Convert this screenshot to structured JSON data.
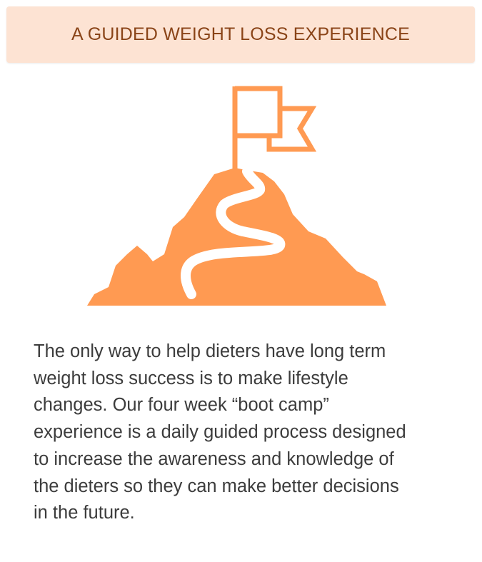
{
  "header": {
    "title": "A GUIDED WEIGHT LOSS EXPERIENCE"
  },
  "illustration": {
    "icon": "mountain-flag-icon",
    "color": "#ff9a52"
  },
  "description": {
    "text": "The only way to help dieters have long term\nweight loss success is to make lifestyle\nchanges. Our four week “boot camp”\nexperience is a daily guided process designed\nto increase the awareness and knowledge of\nthe dieters so they can make better decisions\nin the future."
  },
  "colors": {
    "banner_background": "#fde3d3",
    "banner_text": "#8a4418",
    "body_text": "#3c3c3c",
    "accent": "#ff9a52"
  }
}
